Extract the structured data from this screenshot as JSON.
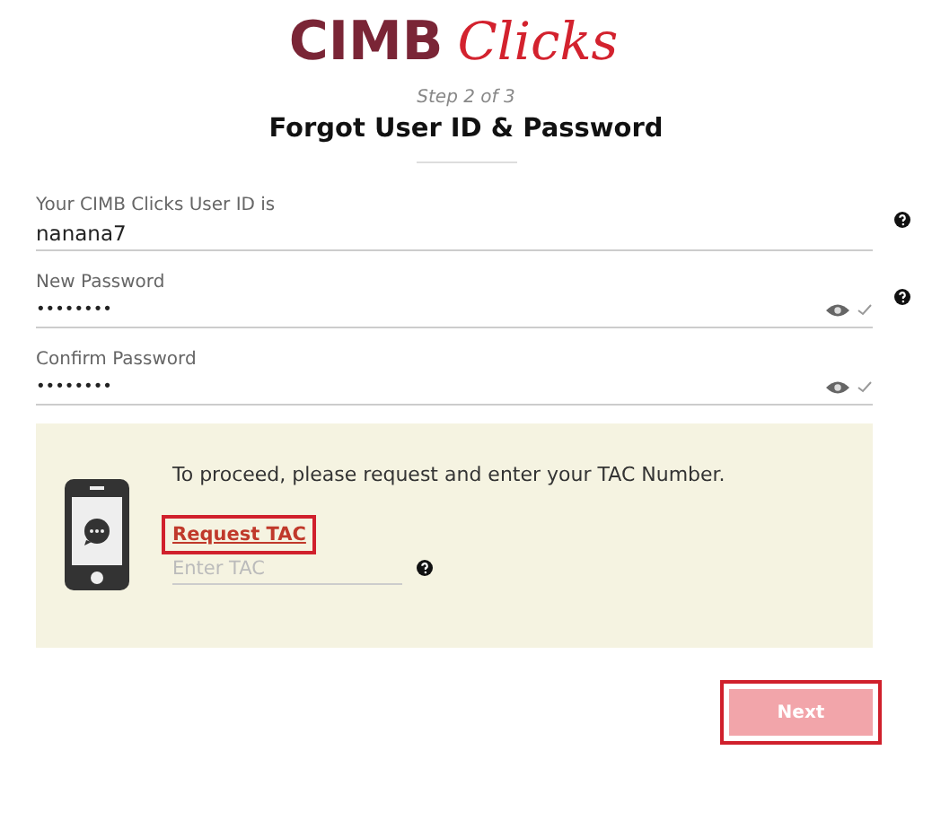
{
  "logo": {
    "brand": "CIMB",
    "product": "Clicks"
  },
  "header": {
    "step": "Step 2 of 3",
    "title": "Forgot User ID & Password"
  },
  "fields": [
    {
      "kind": "text",
      "label": "Your CIMB Clicks User ID is",
      "value": "nanana7",
      "help": true,
      "valid": false
    },
    {
      "kind": "password",
      "label": "New Password",
      "value": "••••••••",
      "help": true,
      "valid": true
    },
    {
      "kind": "password",
      "label": "Confirm Password",
      "value": "••••••••",
      "help": false,
      "valid": true
    }
  ],
  "tac": {
    "message": "To proceed, please request and enter your TAC Number.",
    "request_link": {
      "label": "Request TAC",
      "highlighted": true
    },
    "input": {
      "placeholder": "Enter TAC",
      "help": true
    }
  },
  "next_button": {
    "label": "Next",
    "disabled": true,
    "highlighted": true
  }
}
